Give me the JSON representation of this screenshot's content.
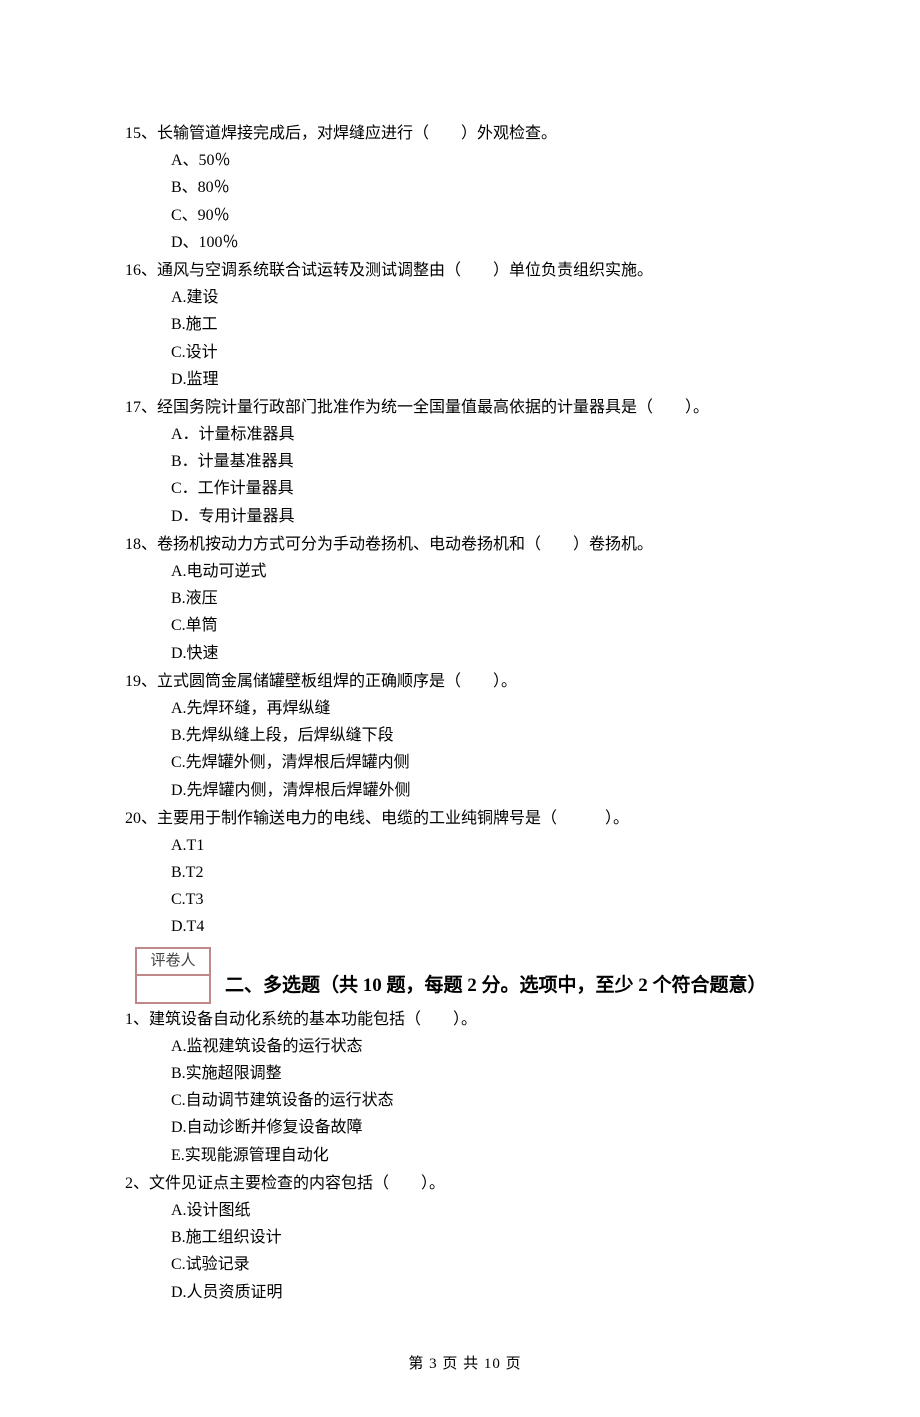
{
  "questions": [
    {
      "num": "15、",
      "text": "长输管道焊接完成后，对焊缝应进行（　　）外观检查。",
      "options": [
        "A、50％",
        "B、80％",
        "C、90％",
        "D、100％"
      ]
    },
    {
      "num": "16、",
      "text": "通风与空调系统联合试运转及测试调整由（　　）单位负责组织实施。",
      "options": [
        "A.建设",
        "B.施工",
        "C.设计",
        "D.监理"
      ]
    },
    {
      "num": "17、",
      "text": "经国务院计量行政部门批准作为统一全国量值最高依据的计量器具是（　　）。",
      "options": [
        "A．计量标准器具",
        "B．计量基准器具",
        "C．工作计量器具",
        "D．专用计量器具"
      ]
    },
    {
      "num": "18、",
      "text": "卷扬机按动力方式可分为手动卷扬机、电动卷扬机和（　　）卷扬机。",
      "options": [
        "A.电动可逆式",
        "B.液压",
        "C.单筒",
        "D.快速"
      ]
    },
    {
      "num": "19、",
      "text": "立式圆筒金属储罐壁板组焊的正确顺序是（　　）。",
      "options": [
        "A.先焊环缝，再焊纵缝",
        "B.先焊纵缝上段，后焊纵缝下段",
        "C.先焊罐外侧，清焊根后焊罐内侧",
        "D.先焊罐内侧，清焊根后焊罐外侧"
      ]
    },
    {
      "num": "20、",
      "text": "主要用于制作输送电力的电线、电缆的工业纯铜牌号是（　　　）。",
      "options": [
        "A.T1",
        "B.T2",
        "C.T3",
        "D.T4"
      ]
    }
  ],
  "grader_label": "评卷人",
  "section2_title": "二、多选题（共 10 题，每题 2 分。选项中，至少 2 个符合题意）",
  "section2_questions": [
    {
      "num": "1、",
      "text": "建筑设备自动化系统的基本功能包括（　　）。",
      "options": [
        "A.监视建筑设备的运行状态",
        "B.实施超限调整",
        "C.自动调节建筑设备的运行状态",
        "D.自动诊断并修复设备故障",
        "E.实现能源管理自动化"
      ]
    },
    {
      "num": "2、",
      "text": "文件见证点主要检查的内容包括（　　）。",
      "options": [
        "A.设计图纸",
        "B.施工组织设计",
        "C.试验记录",
        "D.人员资质证明"
      ]
    }
  ],
  "footer": "第 3 页 共 10 页"
}
